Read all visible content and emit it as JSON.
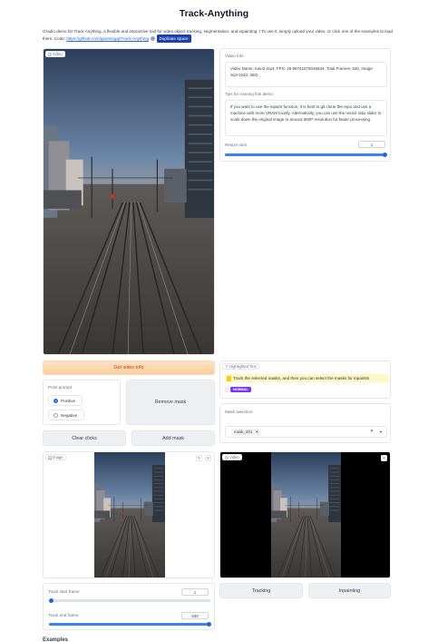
{
  "title": "Track-Anything",
  "description": {
    "text": "Gradio demo for Track Anything, a flexible and interactive tool for video object tracking, segmentation, and inpainting. I To use it, simply upload your video, or click one of the examples to load them. Code: ",
    "link_text": "https://github.com/gaomingqi/Track-Anything",
    "badge": "Duplicate Space"
  },
  "video_input": {
    "label": "Video"
  },
  "video_info": {
    "label": "Video Info",
    "value": "Video Name: train2.mp4, FPS: 29.99761876045634, Total Frames: 630, Image Size:(640, 360)"
  },
  "tips": {
    "label": "Tips for running this demo.",
    "value": "If you want to use the inpaint function, it is best to git clone the repo and use a machine with more VRAM locally. Alternatively, you can use the resize ratio slider to scale down the original image to around 360P resolution for faster processing."
  },
  "resize_ratio": {
    "label": "Resize ratio",
    "value": "1",
    "fraction": 1.0
  },
  "get_video_info_button": "Get video info",
  "point_prompt": {
    "label": "Point prompt",
    "options": [
      "Positive",
      "Negative"
    ],
    "selected": "Positive"
  },
  "remove_mask_button": "Remove mask",
  "clear_clicks_button": "Clear clicks",
  "add_mask_button": "Add mask",
  "highlighted": {
    "label": "Highlighted Text",
    "text": "Track the selected masks, and then you can select the masks for inpaintin",
    "badge": "NORMAL"
  },
  "mask_selection": {
    "label": "Mask selection",
    "chip": "mask_001"
  },
  "image_output": {
    "label": "Image"
  },
  "video_output": {
    "label": "Video"
  },
  "tracking_button": "Tracking",
  "inpainting_button": "Inpainting",
  "track_start": {
    "label": "Track start frame",
    "value": "1",
    "fraction": 0.0
  },
  "track_end": {
    "label": "Track end frame",
    "value": "630",
    "fraction": 1.0
  },
  "footer_text": "Examples",
  "colors": {
    "accent": "#2563eb",
    "primary_button": "#fbcf9e",
    "badge_purple": "#7c3aed"
  }
}
